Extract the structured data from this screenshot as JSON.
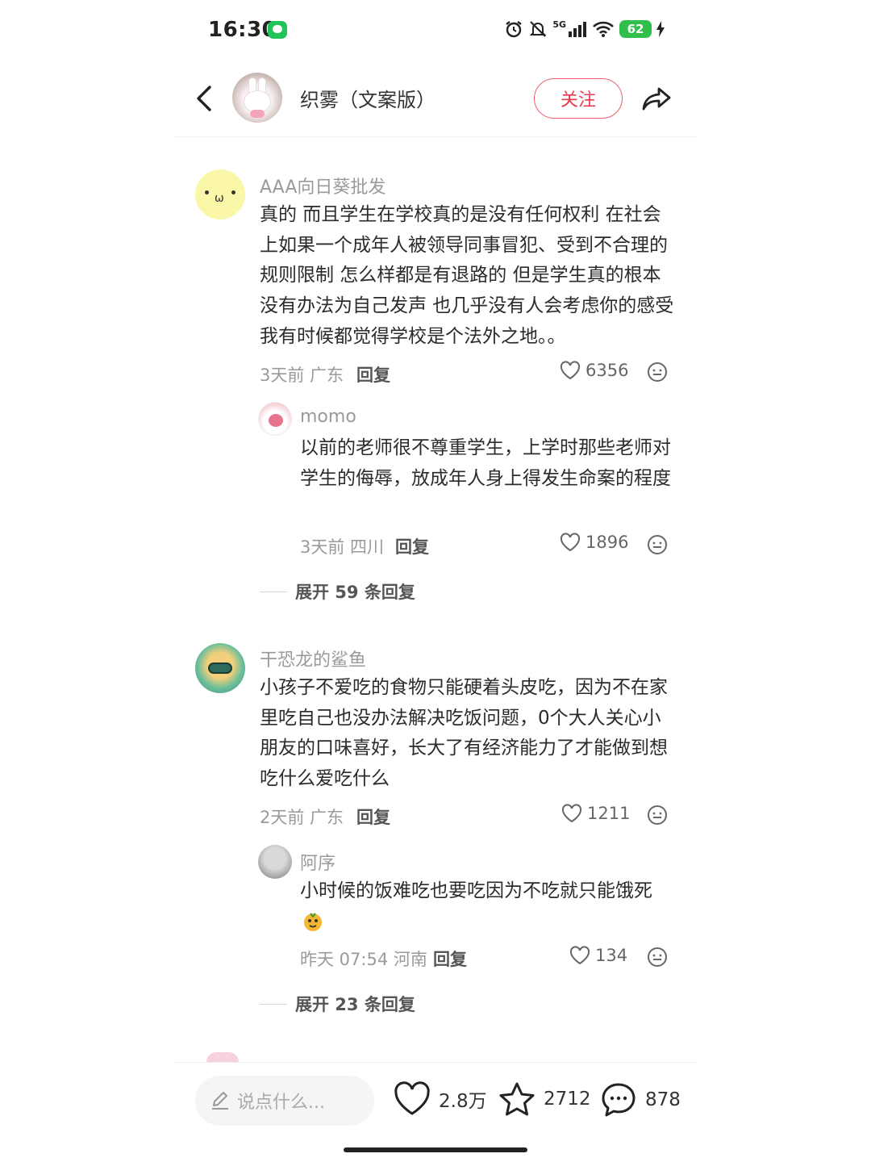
{
  "status_bar": {
    "time": "16:30",
    "network": "5G",
    "battery": "62"
  },
  "header": {
    "title": "织雾（文案版）",
    "follow_label": "关注"
  },
  "comments": [
    {
      "author": "AAA向日葵批发",
      "text": "真的 而且学生在学校真的是没有任何权利 在社会上如果一个成年人被领导同事冒犯、受到不合理的规则限制 怎么样都是有退路的 但是学生真的根本没有办法为自己发声 也几乎没有人会考虑你的感受 我有时候都觉得学校是个法外之地。。",
      "meta": "3天前 广东",
      "reply_label": "回复",
      "likes": "6356",
      "sub_reply": {
        "author": "momo",
        "text": "以前的老师很不尊重学生，上学时那些老师对学生的侮辱，放成年人身上得发生命案的程度",
        "meta": "3天前 四川",
        "reply_label": "回复",
        "likes": "1896"
      },
      "expand_label": "展开 59 条回复"
    },
    {
      "author": "干恐龙的鲨鱼",
      "text": "小孩子不爱吃的食物只能硬着头皮吃，因为不在家里吃自己也没办法解决吃饭问题，0个大人关心小朋友的口味喜好，长大了有经济能力了才能做到想吃什么爱吃什么",
      "meta": "2天前 广东",
      "reply_label": "回复",
      "likes": "1211",
      "sub_reply": {
        "author": "阿序",
        "text": "小时候的饭难吃也要吃因为不吃就只能饿死",
        "meta": "昨天 07:54 河南",
        "reply_label": "回复",
        "likes": "134"
      },
      "expand_label": "展开 23 条回复"
    }
  ],
  "bottom_bar": {
    "input_placeholder": "说点什么...",
    "likes": "2.8万",
    "stars": "2712",
    "comments": "878"
  },
  "colors": {
    "accent": "#ea3a4e",
    "battery": "#2fbf4a"
  }
}
